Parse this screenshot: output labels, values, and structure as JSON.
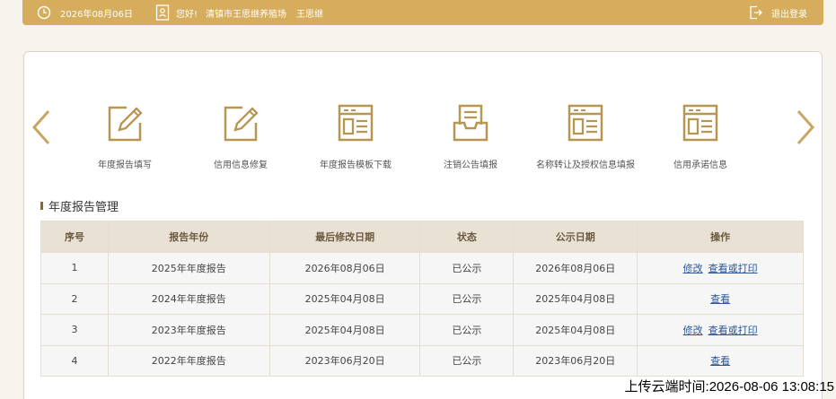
{
  "header": {
    "date": "2026年08月06日",
    "greeting": "您好!",
    "farm_name": "清镇市王思继养殖场",
    "user_name": "王思继",
    "logout_label": "退出登录"
  },
  "nav": {
    "tiles": [
      {
        "label": "年度报告填写",
        "icon": "edit-icon"
      },
      {
        "label": "信用信息修复",
        "icon": "edit-icon"
      },
      {
        "label": "年度报告模板下载",
        "icon": "form-icon"
      },
      {
        "label": "注销公告填报",
        "icon": "inbox-icon"
      },
      {
        "label": "名称转让及授权信息填报",
        "icon": "form-icon"
      },
      {
        "label": "信用承诺信息",
        "icon": "form-icon"
      }
    ]
  },
  "section": {
    "title": "年度报告管理"
  },
  "table": {
    "headers": [
      "序号",
      "报告年份",
      "最后修改日期",
      "状态",
      "公示日期",
      "操作"
    ],
    "rows": [
      {
        "no": "1",
        "year": "2025年年度报告",
        "modified": "2026年08月06日",
        "status": "已公示",
        "published": "2026年08月06日",
        "actions": [
          "修改",
          "查看或打印"
        ]
      },
      {
        "no": "2",
        "year": "2024年年度报告",
        "modified": "2025年04月08日",
        "status": "已公示",
        "published": "2025年04月08日",
        "actions": [
          "查看"
        ]
      },
      {
        "no": "3",
        "year": "2023年年度报告",
        "modified": "2025年04月08日",
        "status": "已公示",
        "published": "2025年04月08日",
        "actions": [
          "修改",
          "查看或打印"
        ]
      },
      {
        "no": "4",
        "year": "2022年年度报告",
        "modified": "2023年06月20日",
        "status": "已公示",
        "published": "2023年06月20日",
        "actions": [
          "查看"
        ]
      }
    ]
  },
  "upload_stamp": "上传云端时间:2026-08-06 13:08:15",
  "colors": {
    "brand_gold": "#d5ad5c",
    "link_blue": "#2a5595",
    "header_row": "#eae1d5"
  }
}
